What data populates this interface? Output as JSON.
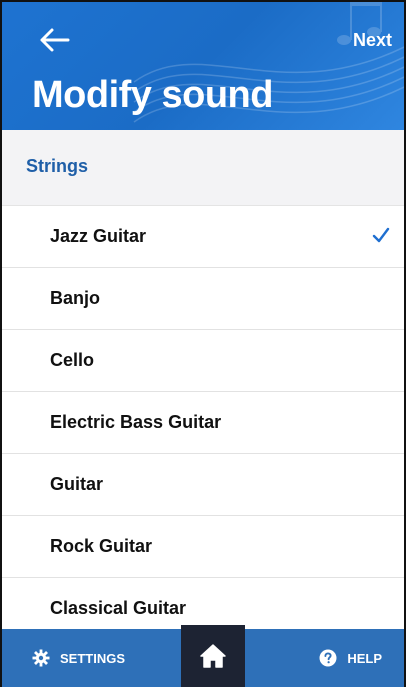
{
  "header": {
    "title": "Modify sound",
    "next_label": "Next"
  },
  "section": {
    "label": "Strings"
  },
  "list": {
    "items": [
      {
        "label": "Jazz Guitar",
        "selected": true
      },
      {
        "label": "Banjo",
        "selected": false
      },
      {
        "label": "Cello",
        "selected": false
      },
      {
        "label": "Electric Bass Guitar",
        "selected": false
      },
      {
        "label": "Guitar",
        "selected": false
      },
      {
        "label": "Rock Guitar",
        "selected": false
      },
      {
        "label": "Classical Guitar",
        "selected": false
      }
    ]
  },
  "bottom_bar": {
    "settings_label": "SETTINGS",
    "help_label": "HELP"
  },
  "colors": {
    "header_blue": "#1e73d1",
    "accent_blue": "#1f5fa8",
    "bar_blue": "#2e70b8",
    "home_dark": "#1d2333"
  },
  "icons": {
    "back": "arrow-left-icon",
    "check": "checkmark-icon",
    "settings": "gear-icon",
    "home": "home-icon",
    "help": "question-circle-icon"
  }
}
